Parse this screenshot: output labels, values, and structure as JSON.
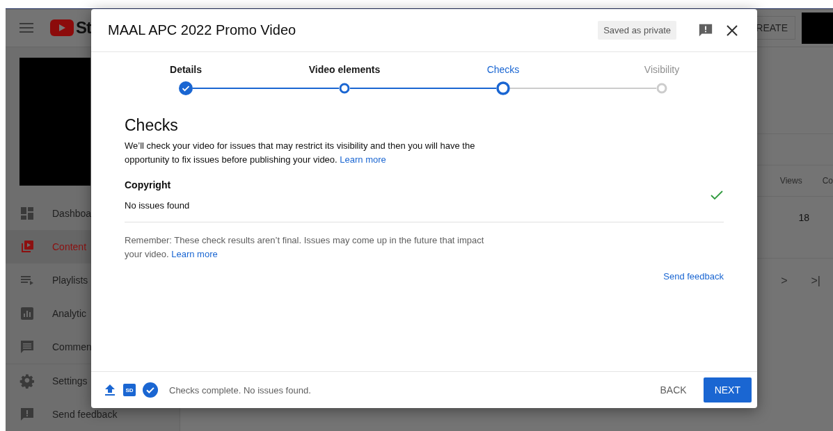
{
  "app": {
    "logo_text": "St",
    "create_button": "REATE"
  },
  "sidebar": {
    "items": [
      {
        "label": "Dashboa",
        "selected": false
      },
      {
        "label": "Content",
        "selected": true
      },
      {
        "label": "Playlists",
        "selected": false
      },
      {
        "label": "Analytic",
        "selected": false
      },
      {
        "label": "Commen",
        "selected": false
      },
      {
        "label": "Settings",
        "selected": false
      },
      {
        "label": "Send feedback",
        "selected": false
      }
    ]
  },
  "table": {
    "columns": [
      "Views",
      "Co"
    ],
    "rows": [
      [
        "18"
      ]
    ],
    "pagination": [
      ">",
      ">|"
    ]
  },
  "dialog": {
    "title": "MAAL APC 2022 Promo Video",
    "status_badge": "Saved as private",
    "steps": [
      {
        "label": "Details",
        "kind": "done"
      },
      {
        "label": "Video elements",
        "kind": "visited"
      },
      {
        "label": "Checks",
        "kind": "current"
      },
      {
        "label": "Visibility",
        "kind": "upcoming"
      }
    ],
    "heading": "Checks",
    "description": "We’ll check your video for issues that may restrict its visibility and then you will have the opportunity to fix issues before publishing your video.",
    "description_link": "Learn more",
    "sections": [
      {
        "title": "Copyright",
        "result": "No issues found",
        "passed": true
      }
    ],
    "note": "Remember: These check results aren’t final. Issues may come up in the future that impact your video.",
    "note_link": "Learn more",
    "send_feedback": "Send feedback",
    "footer": {
      "quality_badge": "SD",
      "status": "Checks complete. No issues found.",
      "back_button": "BACK",
      "next_button": "NEXT"
    }
  }
}
